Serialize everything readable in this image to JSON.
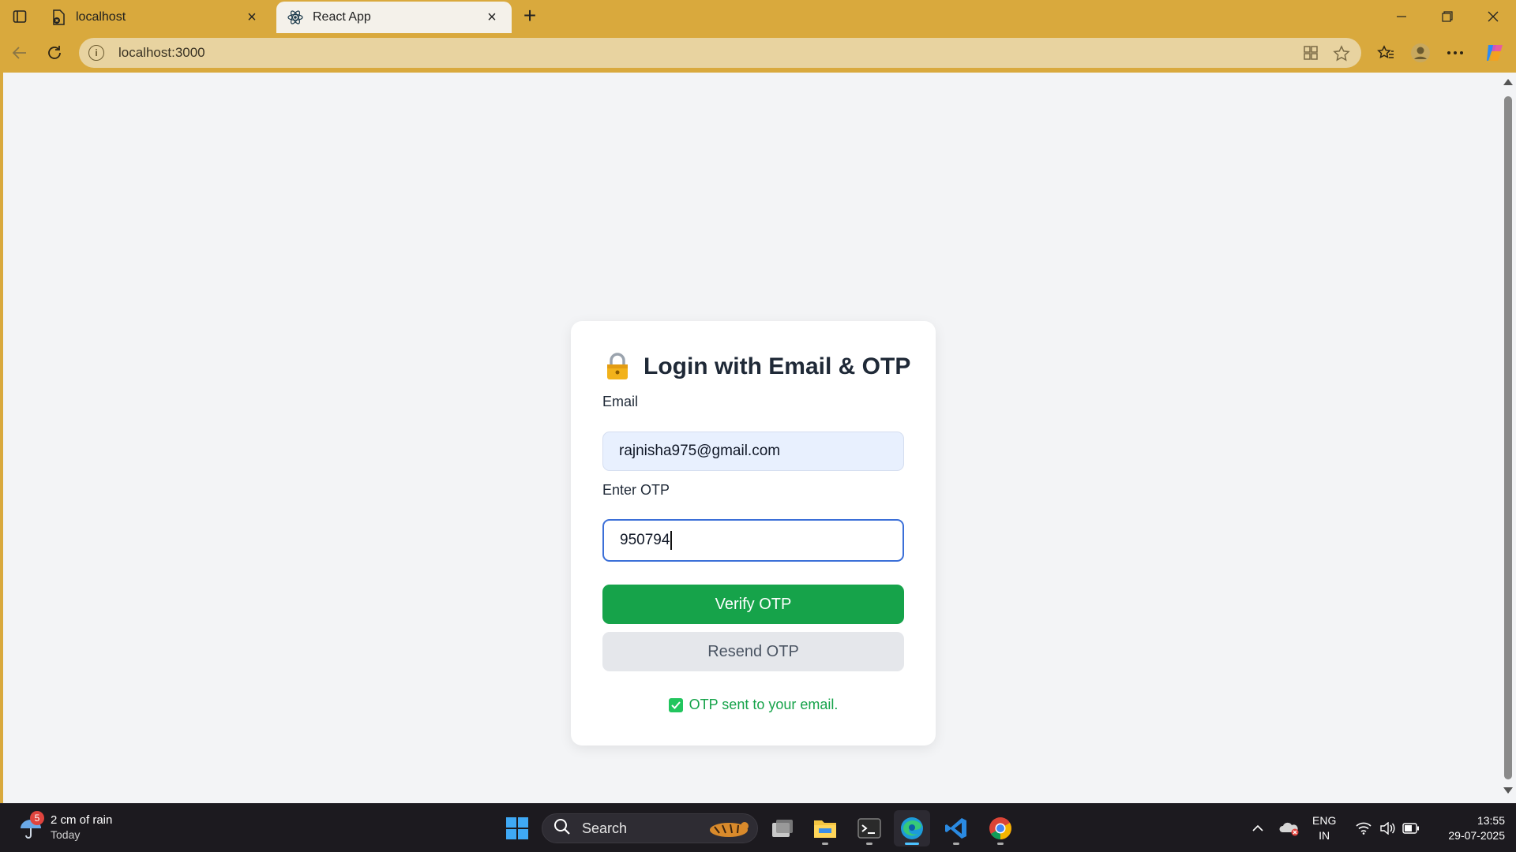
{
  "browser": {
    "tabs": [
      {
        "label": "localhost",
        "active": false
      },
      {
        "label": "React App",
        "active": true
      }
    ],
    "address_url": "localhost:3000"
  },
  "login": {
    "title": "Login with Email & OTP",
    "email_label": "Email",
    "email_value": "rajnisha975@gmail.com",
    "otp_label": "Enter OTP",
    "otp_value": "950794",
    "verify_button": "Verify OTP",
    "resend_button": "Resend OTP",
    "status_message": "OTP sent to your email."
  },
  "taskbar": {
    "weather_badge": "5",
    "weather_main": "2 cm of rain",
    "weather_sub": "Today",
    "search_label": "Search",
    "lang_line1": "ENG",
    "lang_line2": "IN",
    "time": "13:55",
    "date": "29-07-2025"
  },
  "colors": {
    "browser_frame": "#d9a93d",
    "page_bg": "#f3f4f6",
    "verify_green": "#16a34a",
    "otp_focus_border": "#3b6fd8",
    "resend_bg": "#e5e7eb"
  },
  "icons": [
    "tab-actions-icon",
    "tab-favicon-localhost-icon",
    "react-icon",
    "close-icon",
    "plus-icon",
    "minimize-icon",
    "restore-icon",
    "back-icon",
    "refresh-icon",
    "info-icon",
    "app-icon",
    "star-icon",
    "favorites-icon",
    "profile-icon",
    "more-icon",
    "copilot-icon",
    "lock-icon",
    "checkbox-icon",
    "weather-icon",
    "windows-icon",
    "search-icon",
    "task-view-icon",
    "file-explorer-icon",
    "terminal-icon",
    "edge-icon",
    "vscode-icon",
    "chrome-icon",
    "chevron-up-icon",
    "onedrive-icon",
    "wifi-icon",
    "volume-icon",
    "battery-icon"
  ]
}
